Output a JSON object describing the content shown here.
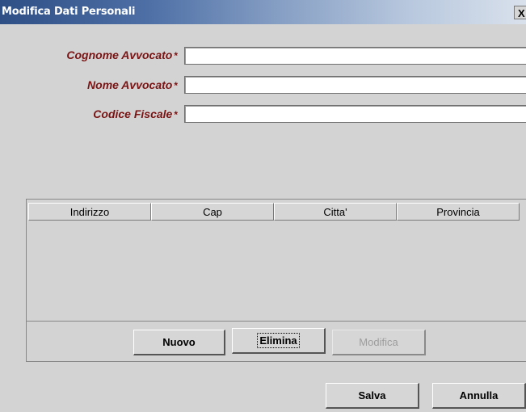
{
  "window": {
    "title": "Modifica Dati Personali",
    "close_label": "X"
  },
  "form": {
    "cognome_label": "Cognome Avvocato",
    "nome_label": "Nome Avvocato",
    "codice_fiscale_label": "Codice Fiscale",
    "required_mark": "*",
    "cognome_value": "",
    "nome_value": "",
    "codice_fiscale_value": ""
  },
  "table": {
    "columns": [
      "Indirizzo",
      "Cap",
      "Citta'",
      "Provincia"
    ],
    "rows": []
  },
  "table_buttons": {
    "nuovo": "Nuovo",
    "elimina": "Elimina",
    "modifica": "Modifica"
  },
  "footer_buttons": {
    "salva": "Salva",
    "annulla": "Annulla"
  }
}
